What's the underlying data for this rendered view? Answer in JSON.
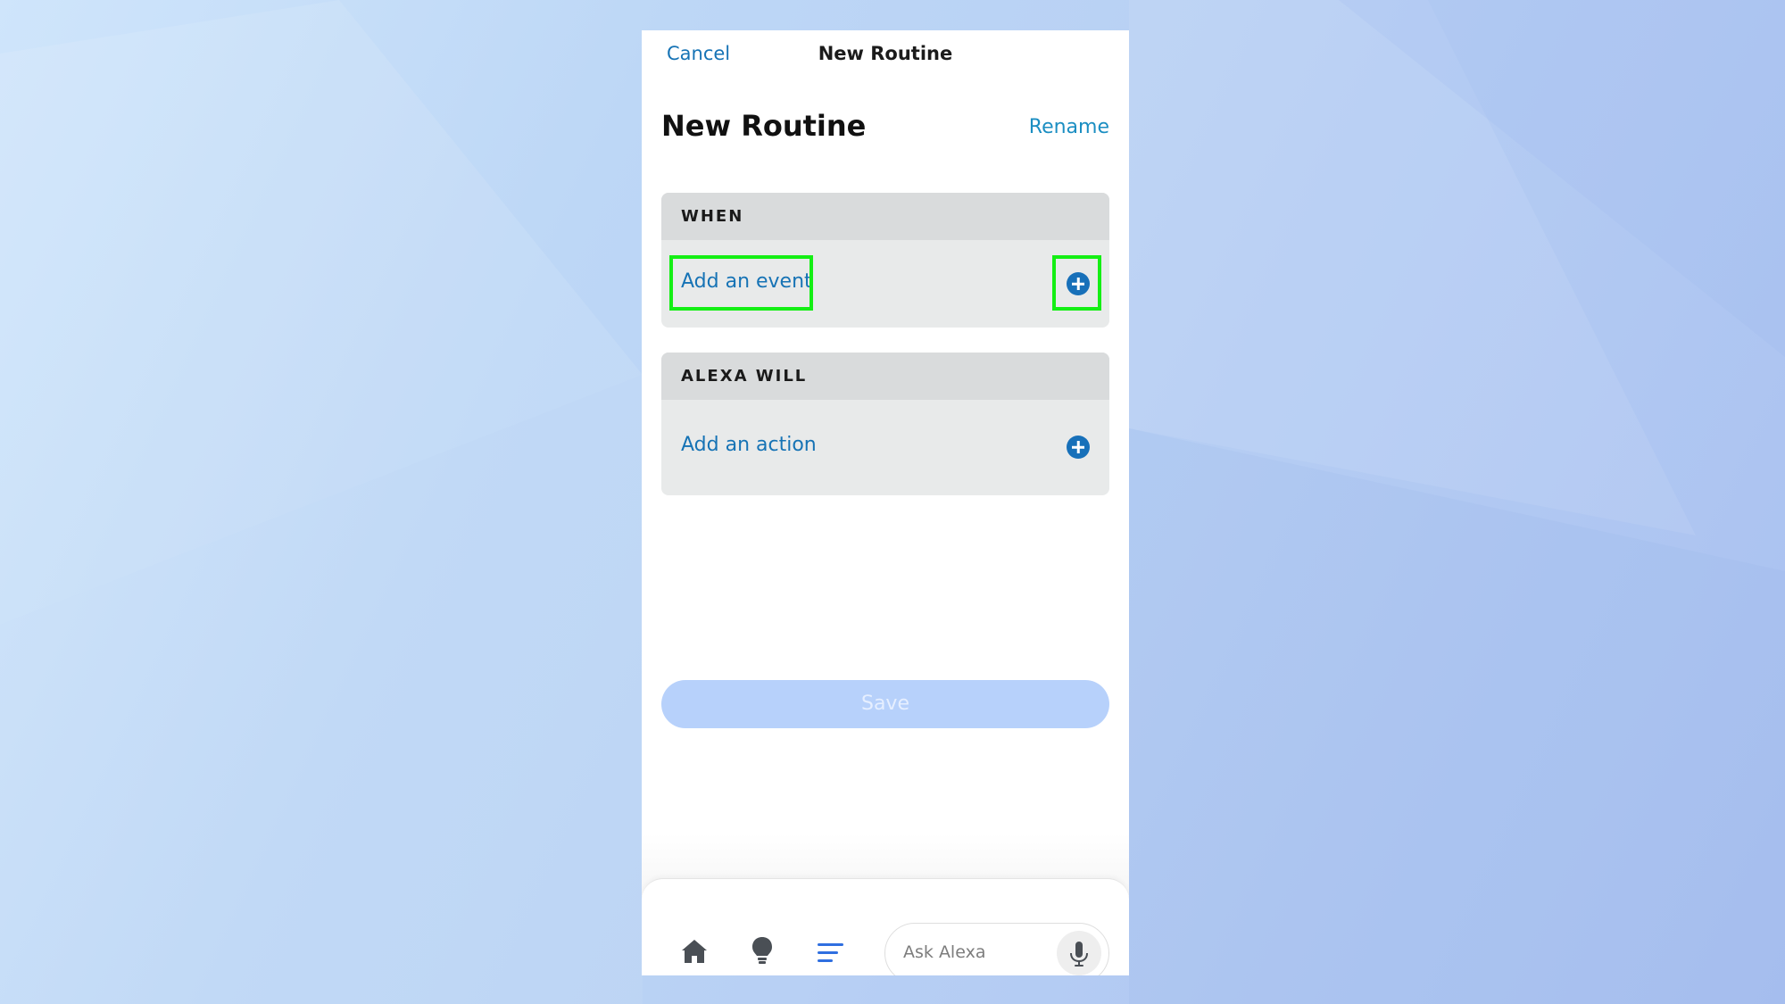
{
  "topbar": {
    "cancel_label": "Cancel",
    "title": "New Routine"
  },
  "heading": "New Routine",
  "rename_label": "Rename",
  "when_section": {
    "header": "WHEN",
    "row_label": "Add an event"
  },
  "alexa_section": {
    "header": "ALEXA WILL",
    "row_label": "Add an action"
  },
  "save_label": "Save",
  "bottom_nav": {
    "icons": [
      "home-icon",
      "lightbulb-icon",
      "menu-lines-icon",
      "microphone-icon"
    ],
    "ask_placeholder": "Ask Alexa"
  },
  "colors": {
    "link_blue": "#1673b5",
    "rename_blue": "#1b8ec2",
    "plus_blue": "#1770b9",
    "highlight_green": "#14ef14",
    "save_disabled": "#b7d1fb",
    "active_nav": "#2f6fe0"
  }
}
